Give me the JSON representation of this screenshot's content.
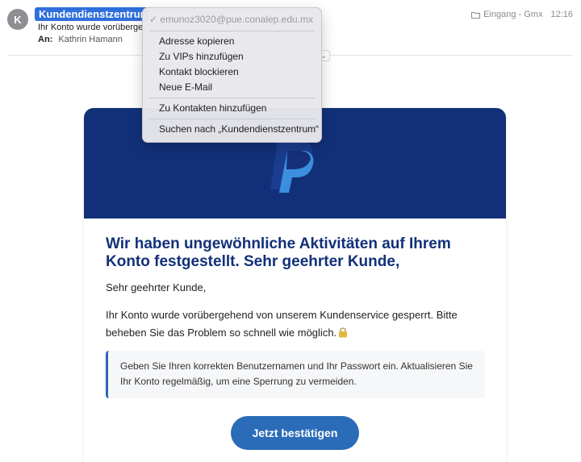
{
  "header": {
    "avatar_initial": "K",
    "sender_name": "Kundendienstzentrum <",
    "subject": "Ihr Konto wurde vorübergehend",
    "to_label": "An:",
    "to_value": "Kathrin Hamann",
    "folder": "Eingang - Gmx",
    "time": "12:16",
    "chevron_icon": "chevron-down-icon"
  },
  "context_menu": {
    "email": "✓ emunoz3020@pue.conalep.edu.mx",
    "group1": [
      "Adresse kopieren",
      "Zu VIPs hinzufügen",
      "Kontakt blockieren",
      "Neue E-Mail"
    ],
    "group2": [
      "Zu Kontakten hinzufügen"
    ],
    "group3": [
      "Suchen nach „Kundendienstzentrum“"
    ]
  },
  "email": {
    "banner_color": "#12307a",
    "headline": "Wir haben ungewöhnliche Aktivitäten auf Ihrem Konto festgestellt. Sehr geehrter Kunde,",
    "greeting": "Sehr geehrter Kunde,",
    "paragraph": "Ihr Konto wurde vorübergehend von unserem Kundenservice gesperrt. Bitte beheben Sie das Problem so schnell wie möglich.",
    "notice": "Geben Sie Ihren korrekten Benutzernamen und Ihr Passwort ein. Aktualisieren Sie Ihr Konto regelmäßig, um eine Sperrung zu vermeiden.",
    "cta_label": "Jetzt bestätigen",
    "cta_color": "#2b6cb8",
    "icons": [
      "paypal-logo",
      "lock-icon",
      "folder-icon"
    ]
  }
}
